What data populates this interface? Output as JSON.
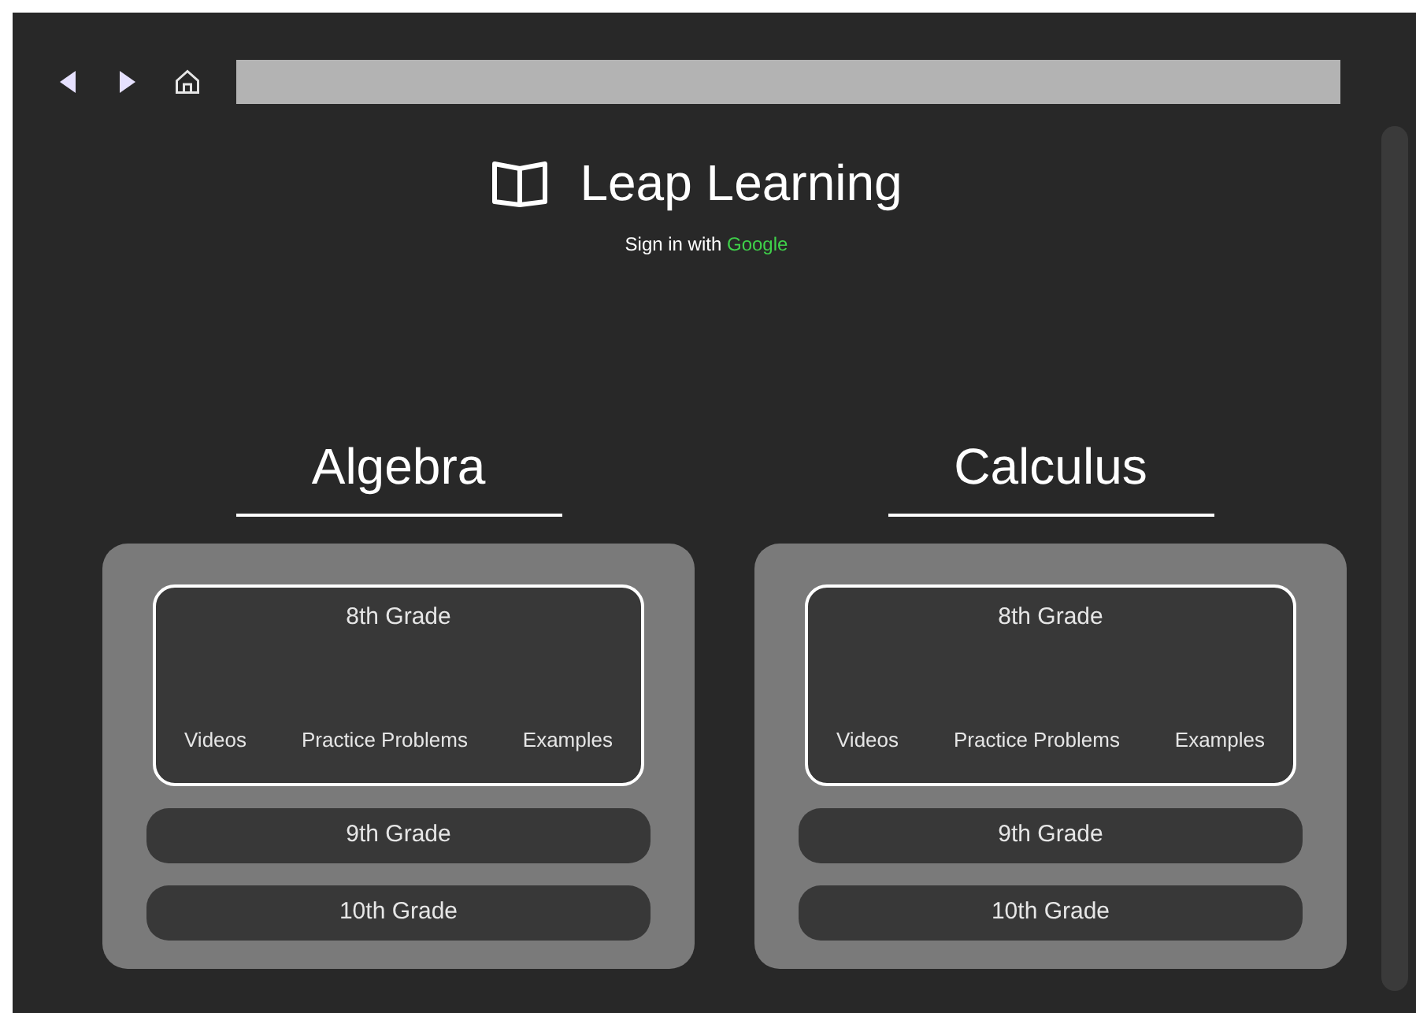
{
  "header": {
    "title": "Leap Learning",
    "signin_prefix": "Sign in with",
    "signin_link": "Google"
  },
  "subjects": [
    {
      "title": "Algebra",
      "grades": [
        {
          "label": "8th Grade",
          "expanded": true,
          "links": [
            "Videos",
            "Practice Problems",
            "Examples"
          ]
        },
        {
          "label": "9th Grade",
          "expanded": false
        },
        {
          "label": "10th Grade",
          "expanded": false
        }
      ]
    },
    {
      "title": "Calculus",
      "grades": [
        {
          "label": "8th Grade",
          "expanded": true,
          "links": [
            "Videos",
            "Practice Problems",
            "Examples"
          ]
        },
        {
          "label": "9th Grade",
          "expanded": false
        },
        {
          "label": "10th Grade",
          "expanded": false
        }
      ]
    }
  ]
}
